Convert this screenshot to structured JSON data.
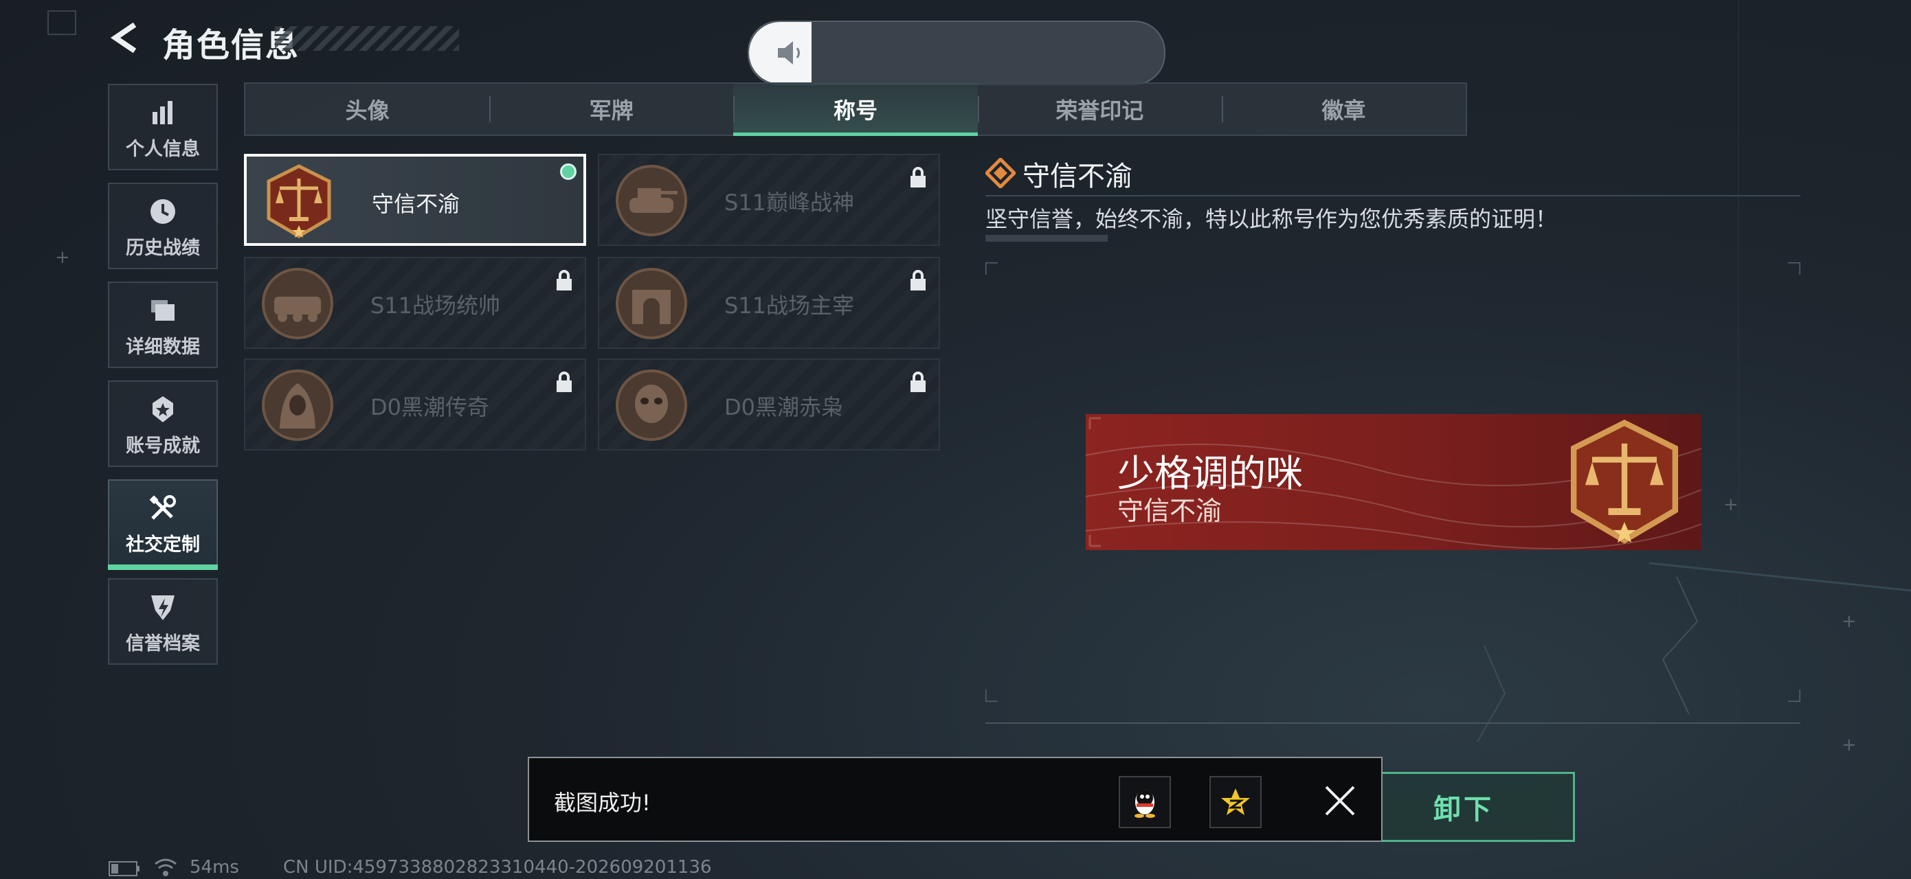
{
  "header": {
    "title": "角色信息"
  },
  "sidebar": {
    "items": [
      {
        "label": "个人信息"
      },
      {
        "label": "历史战绩"
      },
      {
        "label": "详细数据"
      },
      {
        "label": "账号成就"
      },
      {
        "label": "社交定制"
      },
      {
        "label": "信誉档案"
      }
    ],
    "active_index": 4
  },
  "tabs": [
    {
      "label": "头像"
    },
    {
      "label": "军牌"
    },
    {
      "label": "称号"
    },
    {
      "label": "荣誉印记"
    },
    {
      "label": "徽章"
    }
  ],
  "active_tab": 2,
  "volume": {
    "level_percent": 15
  },
  "titles": [
    {
      "name": "守信不渝",
      "equipped": true,
      "locked": false
    },
    {
      "name": "S11巅峰战神",
      "equipped": false,
      "locked": true
    },
    {
      "name": "S11战场统帅",
      "equipped": false,
      "locked": true
    },
    {
      "name": "S11战场主宰",
      "equipped": false,
      "locked": true
    },
    {
      "name": "D0黑潮传奇",
      "equipped": false,
      "locked": true
    },
    {
      "name": "D0黑潮赤枭",
      "equipped": false,
      "locked": true
    }
  ],
  "detail": {
    "title": "守信不渝",
    "description": "坚守信誉，始终不渝，特以此称号作为您优秀素质的证明！"
  },
  "banner": {
    "player_name": "少格调的咪",
    "title": "守信不渝"
  },
  "unequip_button": {
    "label": "卸下"
  },
  "toast": {
    "message": "截图成功!"
  },
  "status_bar": {
    "ping": "54ms",
    "uid": "CN UID:4597338802823310440-202609201136"
  },
  "colors": {
    "accent": "#5fd3a2",
    "banner": "#8c2420",
    "medal_gold": "#c9924e"
  }
}
